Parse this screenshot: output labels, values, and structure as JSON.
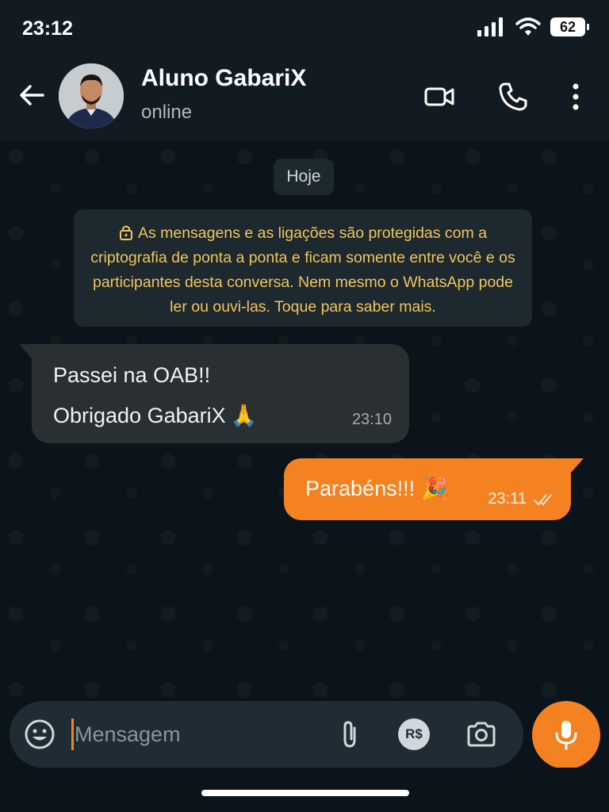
{
  "status_bar": {
    "time": "23:12",
    "battery": "62",
    "icons": [
      "signal-icon",
      "wifi-icon",
      "battery-icon"
    ]
  },
  "header": {
    "contact_name": "Aluno GabariX",
    "status": "online",
    "icons": [
      "back-arrow-icon",
      "video-call-icon",
      "voice-call-icon",
      "more-options-icon"
    ]
  },
  "chat": {
    "date_chip": "Hoje",
    "encryption_notice": "As mensagens e as ligações são protegidas com a criptografia de ponta a ponta e ficam somente entre você e os participantes desta conversa. Nem mesmo o WhatsApp pode ler ou ouvi-las. Toque para saber mais.",
    "messages": [
      {
        "direction": "incoming",
        "line1": "Passei na OAB!!",
        "line2": "Obrigado GabariX",
        "emoji": "🙏",
        "time": "23:10"
      },
      {
        "direction": "outgoing",
        "text": "Parabéns!!!",
        "emoji": "🎉",
        "time": "23:11",
        "status_icon": "double-check-icon"
      }
    ]
  },
  "input": {
    "placeholder": "Mensagem",
    "pix_label": "R$",
    "icons": [
      "emoji-icon",
      "attach-icon",
      "camera-icon",
      "mic-icon"
    ]
  },
  "colors": {
    "accent": "#f58220",
    "background": "#0b141a",
    "header": "#111b21",
    "incoming_bubble": "#2a2f32",
    "notice_text": "#f1c65a"
  }
}
